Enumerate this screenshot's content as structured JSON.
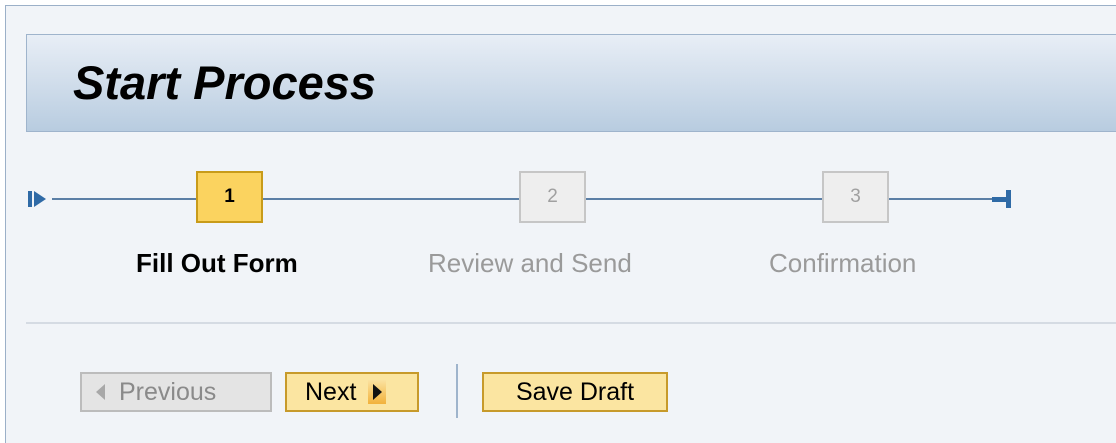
{
  "header": {
    "title": "Start Process"
  },
  "roadmap": {
    "steps": [
      {
        "number": "1",
        "label": "Fill Out Form",
        "state": "active"
      },
      {
        "number": "2",
        "label": "Review and Send",
        "state": "inactive"
      },
      {
        "number": "3",
        "label": "Confirmation",
        "state": "inactive"
      }
    ]
  },
  "toolbar": {
    "previous_label": "Previous",
    "next_label": "Next",
    "save_draft_label": "Save Draft"
  },
  "colors": {
    "accent": "#fbd35f",
    "line": "#5b7fa6",
    "header_gradient_top": "#e8eef6",
    "header_gradient_bottom": "#b8cce0"
  }
}
